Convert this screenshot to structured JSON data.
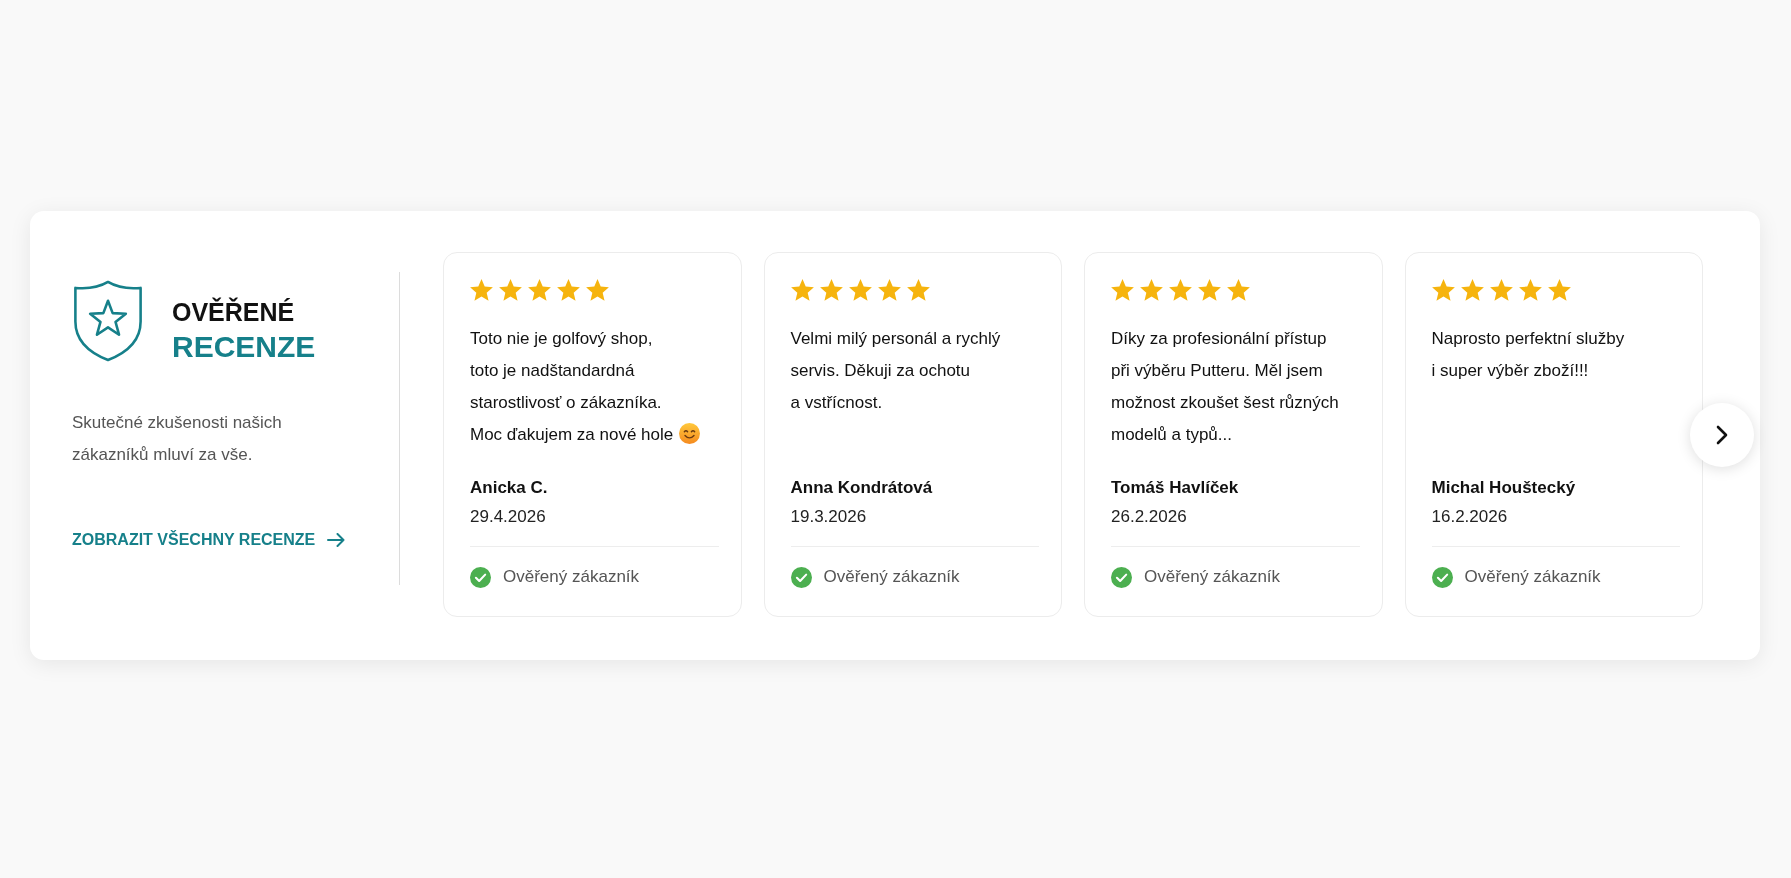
{
  "panel": {
    "heading": {
      "line_1": "OVĚŘENÉ",
      "line_2": "RECENZE"
    },
    "description": "Skutečné zkušenosti našich\nzákazníků mluví za vše.",
    "link": "ZOBRAZIT VŠECHNY RECENZE"
  },
  "reviews": [
    {
      "stars": 5,
      "text": "Toto nie je golfový shop,\ntoto je nadštandardná\nstarostlivosť o zákazníka.\nMoc ďakujem za nové hole",
      "emoji": true,
      "author": "Anicka C.",
      "date": "29.4.2026",
      "verified": true,
      "verified_label": "Ověřený zákazník"
    },
    {
      "stars": 5,
      "text": "Velmi milý personál a rychlý\nservis. Děkuji za ochotu\na vstřícnost.",
      "emoji": false,
      "author": "Anna Kondrátová",
      "date": "19.3.2026",
      "verified": true,
      "verified_label": "Ověřený zákazník"
    },
    {
      "stars": 5,
      "text": "Díky za profesionální přístup\npři výběru Putteru. Měl jsem\nmožnost zkoušet šest různých\nmodelů a typů...",
      "emoji": false,
      "author": "Tomáš Havlíček",
      "date": "26.2.2026",
      "verified": true,
      "verified_label": "Ověřený zákazník"
    },
    {
      "stars": 5,
      "text": "Naprosto perfektní služby\ni super výběr zboží!!!",
      "emoji": false,
      "author": "Michal Houštecký",
      "date": "16.2.2026",
      "verified": true,
      "verified_label": "Ověřený zákazník"
    }
  ]
}
